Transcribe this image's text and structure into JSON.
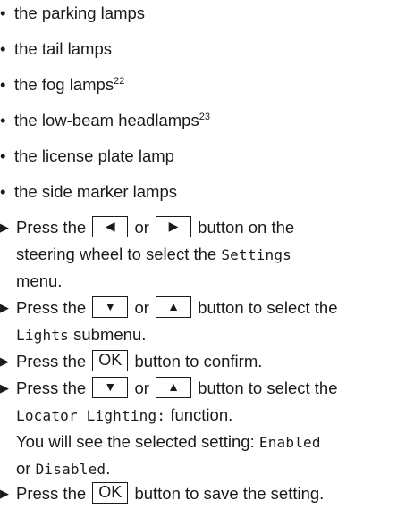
{
  "bullets": [
    {
      "text": "the parking lamps",
      "sup": ""
    },
    {
      "text": "the tail lamps",
      "sup": ""
    },
    {
      "text": "the fog lamps",
      "sup": "22"
    },
    {
      "text": "the low-beam headlamps",
      "sup": "23"
    },
    {
      "text": "the license plate lamp",
      "sup": ""
    },
    {
      "text": "the side marker lamps",
      "sup": ""
    }
  ],
  "bullet_glyph": "•",
  "step_marker": "▶",
  "icons": {
    "left": "◀",
    "right": "▶",
    "down": "▼",
    "up": "▲"
  },
  "ok_label": "OK",
  "steps": {
    "s1": {
      "a": "Press the",
      "or": "or",
      "b": "button on the",
      "c": "steering wheel to select the",
      "d": "Settings",
      "e": "menu."
    },
    "s2": {
      "a": "Press the",
      "or": "or",
      "b": "button to select the",
      "c": "Lights",
      "d": "submenu."
    },
    "s3": {
      "a": "Press the",
      "b": "button to confirm."
    },
    "s4": {
      "a": "Press the",
      "or": "or",
      "b": "button to select the",
      "c": "Locator Lighting:",
      "d": "function.",
      "e": "You will see the selected setting:",
      "f": "Enabled",
      "g": "or",
      "h": "Disabled",
      "i": "."
    },
    "s5": {
      "a": "Press the",
      "b": "button to save the setting."
    }
  }
}
